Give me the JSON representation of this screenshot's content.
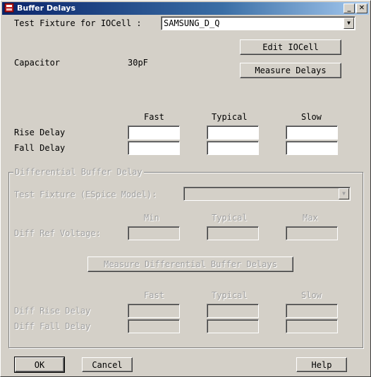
{
  "window": {
    "title": "Buffer Delays",
    "controls": {
      "minimize": "_",
      "maximize": "□",
      "close": "✕"
    }
  },
  "test_fixture": {
    "label": "Test Fixture for IOCell :",
    "selected": "SAMSUNG_D_Q"
  },
  "buttons": {
    "edit_iocell": "Edit IOCell",
    "measure_delays": "Measure Delays",
    "measure_diff": "Measure Differential Buffer Delays",
    "ok": "OK",
    "cancel": "Cancel",
    "help": "Help"
  },
  "capacitor": {
    "label": "Capacitor",
    "value": "30pF"
  },
  "delays": {
    "columns": [
      "Fast",
      "Typical",
      "Slow"
    ],
    "rise_label": "Rise Delay",
    "fall_label": "Fall Delay"
  },
  "differential": {
    "group_title": "Differential Buffer Delay",
    "fixture_label": "Test Fixture (ESpice Model):",
    "fixture_selected": "",
    "voltage_columns": [
      "Min",
      "Typical",
      "Max"
    ],
    "ref_voltage_label": "Diff Ref Voltage:",
    "delay_columns": [
      "Fast",
      "Typical",
      "Slow"
    ],
    "rise_label": "Diff Rise Delay",
    "fall_label": "Diff Fall Delay"
  },
  "colors": {
    "titlebar_start": "#0a246a",
    "titlebar_end": "#a6caf0",
    "background": "#d4d0c8"
  },
  "icons": {
    "app": "app-icon",
    "dropdown": "chevron-down-icon"
  }
}
